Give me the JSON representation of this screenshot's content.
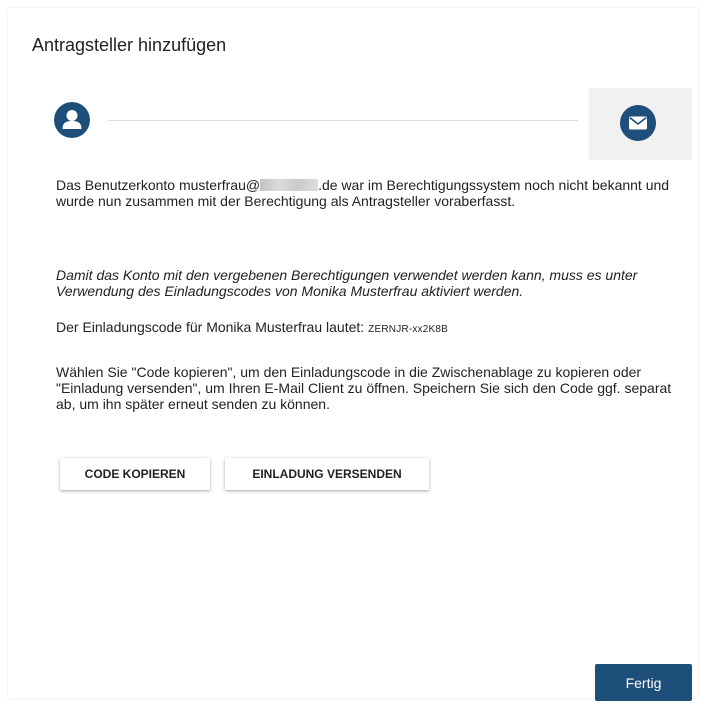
{
  "dialog": {
    "title": "Antragsteller hinzufügen"
  },
  "stepper": {
    "step1_icon": "user-icon",
    "step2_icon": "envelope-icon",
    "accent": "#1e4e7a"
  },
  "message": {
    "p1_before": "Das Benutzerkonto musterfrau@",
    "p1_after": ".de war im Berechtigungssystem noch nicht bekannt und wurde nun zusammen mit der Berechtigung als Antragsteller voraberfasst.",
    "p2": "Damit das Konto mit den vergebenen Berechtigungen verwendet werden kann, muss es unter Verwendung des Einladungscodes von Monika Musterfrau aktiviert werden.",
    "p3_label": "Der Einladungscode für Monika Musterfrau lautet:",
    "code": "ZERNJR-xx2K8B",
    "p4": "Wählen Sie \"Code kopieren\", um den Einladungscode in die Zwischenablage zu kopieren oder \"Einladung versenden\", um Ihren E-Mail Client zu öffnen. Speichern Sie sich den Code ggf. separat ab, um ihn später erneut senden zu können."
  },
  "buttons": {
    "copy": "CODE KOPIEREN",
    "invite": "EINLADUNG VERSENDEN",
    "done": "Fertig"
  }
}
